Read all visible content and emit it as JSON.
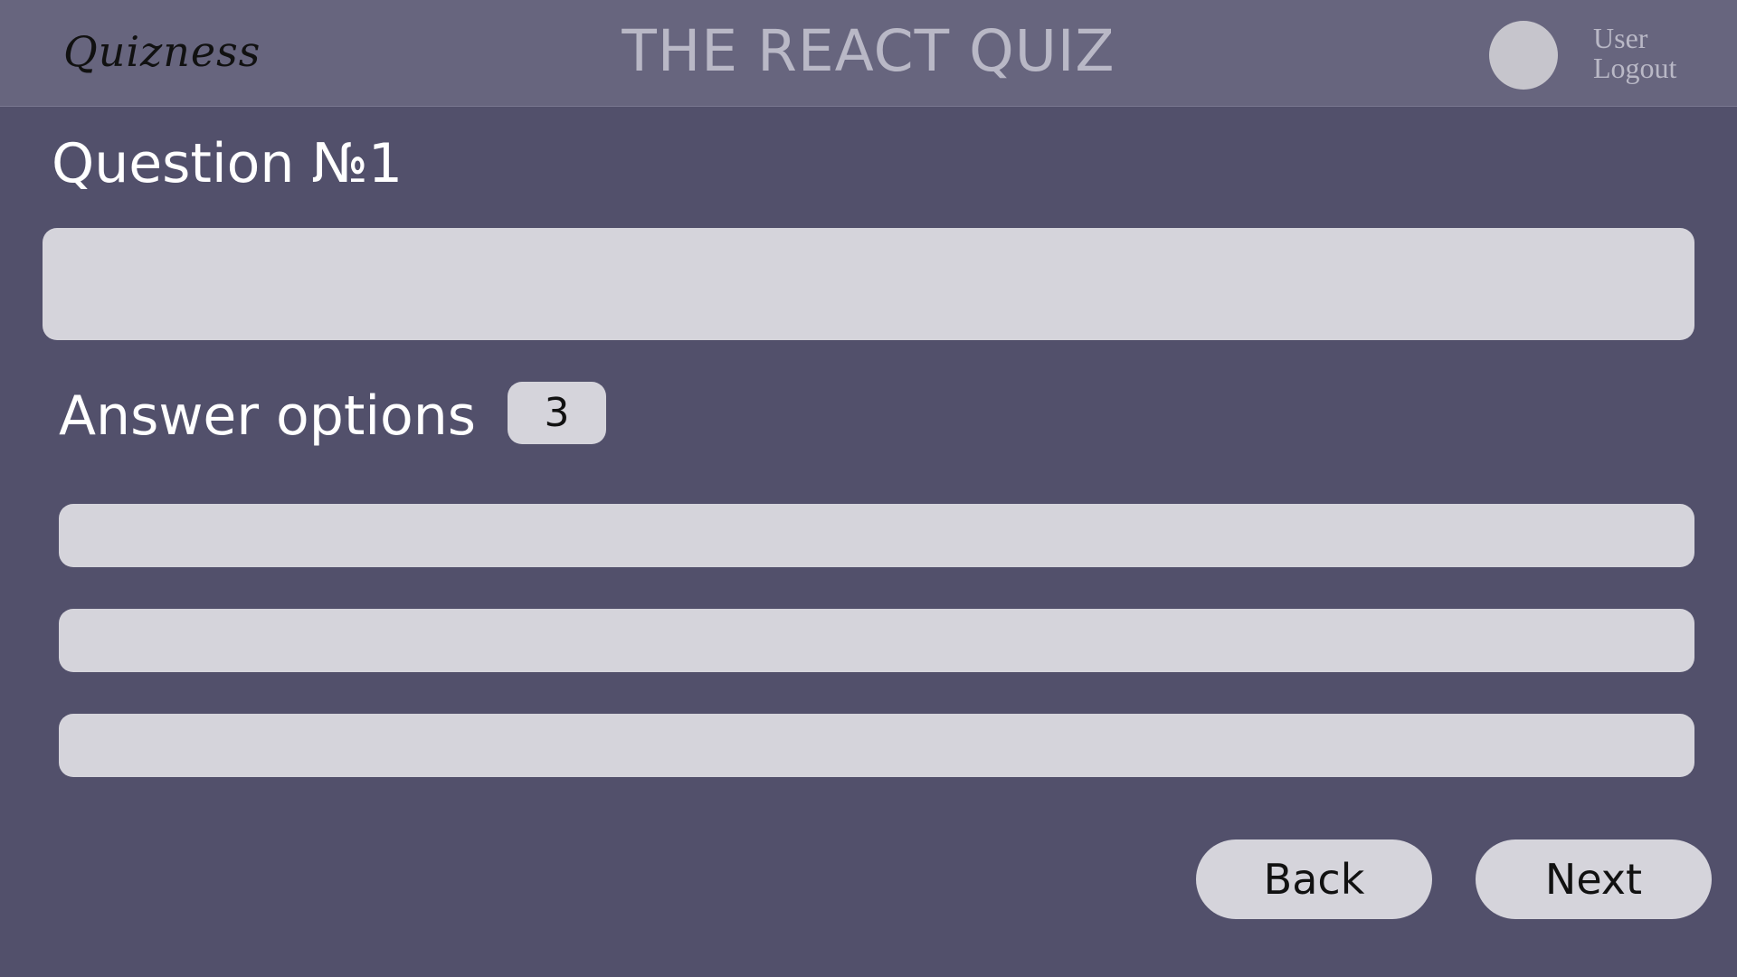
{
  "header": {
    "logo": "Quizness",
    "title": "THE REACT QUIZ",
    "user_label": "User",
    "logout_label": "Logout"
  },
  "question": {
    "title": "Question №1",
    "text_value": "",
    "text_placeholder": ""
  },
  "answers": {
    "label": "Answer options",
    "count": "3",
    "options": [
      {
        "value": "",
        "placeholder": ""
      },
      {
        "value": "",
        "placeholder": ""
      },
      {
        "value": "",
        "placeholder": ""
      }
    ]
  },
  "nav": {
    "back_label": "Back",
    "next_label": "Next"
  },
  "colors": {
    "background": "#52506b",
    "header": "#67657e",
    "field": "#d5d4db",
    "title_text": "#b9b8c6"
  }
}
